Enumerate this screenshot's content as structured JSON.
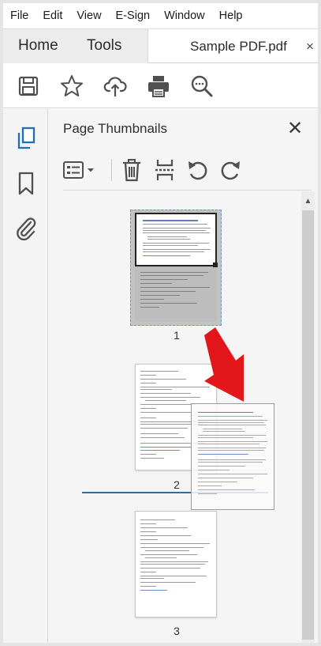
{
  "menu": [
    "File",
    "Edit",
    "View",
    "E-Sign",
    "Window",
    "Help"
  ],
  "tabs": {
    "home": "Home",
    "tools": "Tools",
    "document": "Sample PDF.pdf",
    "close": "×"
  },
  "toolbar_icons": [
    "save-icon",
    "bookmark-star-icon",
    "cloud-upload-icon",
    "print-icon",
    "zoom-search-icon"
  ],
  "left_nav_icons": [
    "page-thumbnails-icon",
    "bookmarks-icon",
    "attachments-icon"
  ],
  "panel": {
    "title": "Page Thumbnails",
    "close": "✕",
    "tool_icons": [
      "thumbnail-options-icon",
      "delete-pages-icon",
      "insert-pages-icon",
      "rotate-counterclockwise-icon",
      "rotate-clockwise-icon"
    ]
  },
  "pages": [
    {
      "number": "1",
      "selected": true
    },
    {
      "number": "2",
      "selected": false
    },
    {
      "number": "3",
      "selected": false
    }
  ],
  "annotation": {
    "arrow_color": "#e3161b",
    "insert_line_color": "#2f6e9e"
  },
  "colors": {
    "accent": "#1f6fb5",
    "selection": "#c3c3c3"
  }
}
